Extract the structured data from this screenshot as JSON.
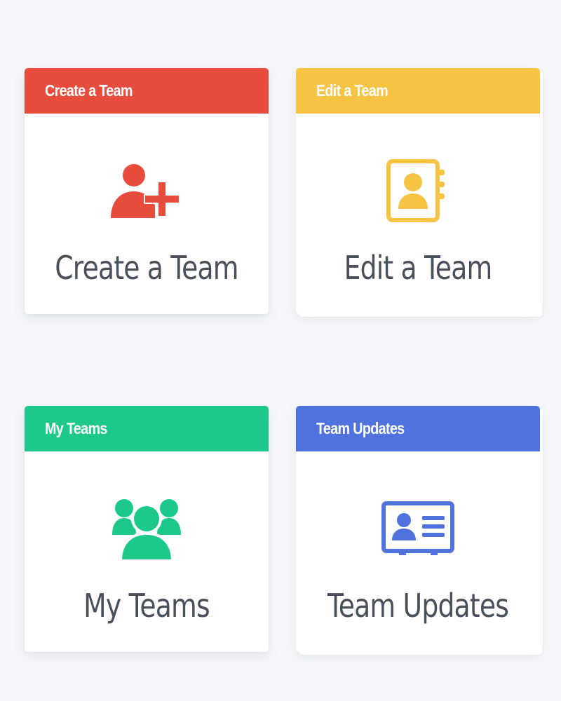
{
  "colors": {
    "page_background": "#f5f7fa",
    "card_background": "#ffffff",
    "title_text": "#4a4f5c",
    "red": "#e74c3c",
    "yellow": "#f6c343",
    "green": "#1dc98a",
    "blue": "#4f72de"
  },
  "cards": [
    {
      "header_label": "Create a Team",
      "title": "Create a Team",
      "color": "#e74c3c",
      "icon": "user-plus-icon"
    },
    {
      "header_label": "Edit a Team",
      "title": "Edit a Team",
      "color": "#f6c343",
      "icon": "address-book-icon"
    },
    {
      "header_label": "My Teams",
      "title": "My Teams",
      "color": "#1dc98a",
      "icon": "users-icon"
    },
    {
      "header_label": "Team Updates",
      "title": "Team Updates",
      "color": "#4f72de",
      "icon": "id-card-icon"
    }
  ]
}
